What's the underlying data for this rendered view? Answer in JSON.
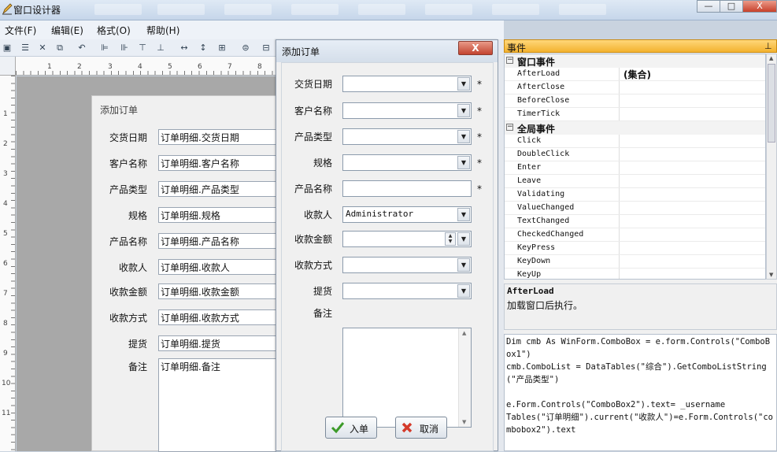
{
  "app": {
    "title": "窗口设计器",
    "minimize": "—",
    "restore": "□",
    "close": "X"
  },
  "menu": [
    {
      "label": "文件(F)"
    },
    {
      "label": "编辑(E)"
    },
    {
      "label": "格式(O)"
    },
    {
      "label": "帮助(H)"
    }
  ],
  "ruler": {
    "h": [
      "1",
      "2",
      "3",
      "4",
      "5",
      "6",
      "7",
      "8"
    ],
    "v": [
      "1",
      "2",
      "3",
      "4",
      "5",
      "6",
      "7",
      "8",
      "9",
      "10",
      "11"
    ]
  },
  "design_form": {
    "title": "添加订单",
    "fields": [
      {
        "label": "交货日期",
        "value": "订单明细.交货日期"
      },
      {
        "label": "客户名称",
        "value": "订单明细.客户名称"
      },
      {
        "label": "产品类型",
        "value": "订单明细.产品类型"
      },
      {
        "label": "规格",
        "value": "订单明细.规格"
      },
      {
        "label": "产品名称",
        "value": "订单明细.产品名称"
      },
      {
        "label": "收款人",
        "value": "订单明细.收款人"
      },
      {
        "label": "收款金额",
        "value": "订单明细.收款金额"
      },
      {
        "label": "收款方式",
        "value": "订单明细.收款方式"
      },
      {
        "label": "提货",
        "value": "订单明细.提货"
      },
      {
        "label": "备注",
        "value": "订单明细.备注"
      }
    ]
  },
  "dialog": {
    "title": "添加订单",
    "close": "X",
    "required_mark": "*",
    "fields": [
      {
        "label": "交货日期",
        "value": ""
      },
      {
        "label": "客户名称",
        "value": ""
      },
      {
        "label": "产品类型",
        "value": ""
      },
      {
        "label": "规格",
        "value": ""
      },
      {
        "label": "产品名称",
        "value": ""
      },
      {
        "label": "收款人",
        "value": "Administrator"
      },
      {
        "label": "收款金额",
        "value": ""
      },
      {
        "label": "收款方式",
        "value": ""
      },
      {
        "label": "提货",
        "value": ""
      },
      {
        "label": "备注",
        "value": ""
      }
    ],
    "ok_button": "入单",
    "cancel_button": "取消"
  },
  "panel": {
    "title": "事件",
    "categories": [
      {
        "label": "窗口事件",
        "events": [
          {
            "name": "AfterLoad",
            "value": "(集合)"
          },
          {
            "name": "AfterClose",
            "value": ""
          },
          {
            "name": "BeforeClose",
            "value": ""
          },
          {
            "name": "TimerTick",
            "value": ""
          }
        ]
      },
      {
        "label": "全局事件",
        "events": [
          {
            "name": "Click",
            "value": ""
          },
          {
            "name": "DoubleClick",
            "value": ""
          },
          {
            "name": "Enter",
            "value": ""
          },
          {
            "name": "Leave",
            "value": ""
          },
          {
            "name": "Validating",
            "value": ""
          },
          {
            "name": "ValueChanged",
            "value": ""
          },
          {
            "name": "TextChanged",
            "value": ""
          },
          {
            "name": "CheckedChanged",
            "value": ""
          },
          {
            "name": "KeyPress",
            "value": ""
          },
          {
            "name": "KeyDown",
            "value": ""
          },
          {
            "name": "KeyUp",
            "value": ""
          }
        ]
      }
    ],
    "desc_title": "AfterLoad",
    "desc_text": "加载窗口后执行。",
    "code": "Dim cmb As WinForm.ComboBox = e.form.Controls(\"ComboBox1\")\ncmb.ComboList = DataTables(\"综合\").GetComboListString(\"产品类型\")\n\ne.Form.Controls(\"ComboBox2\").text= _username\nTables(\"订单明细\").current(\"收款人\")=e.Form.Controls(\"combobox2\").text"
  }
}
